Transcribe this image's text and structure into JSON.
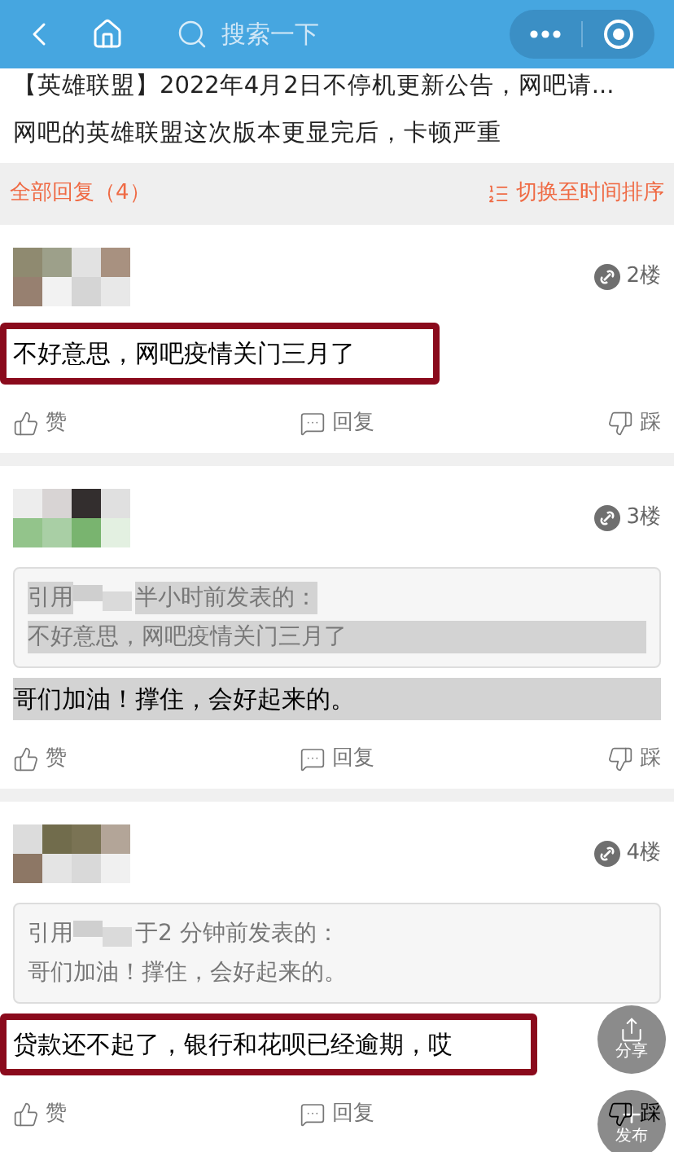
{
  "header": {
    "search_placeholder": "搜索一下"
  },
  "thread": {
    "title": "【英雄联盟】2022年4月2日不停机更新公告，网吧请...",
    "body": "网吧的英雄联盟这次版本更显完后，卡顿严重"
  },
  "replies_bar": {
    "count_label": "全部回复（4）",
    "sort_label": "切换至时间排序"
  },
  "posts": [
    {
      "floor": "2楼",
      "text": "不好意思，网吧疫情关门三月了",
      "highlighted": true,
      "shaded": false,
      "actions": [
        "赞",
        "回复",
        "踩"
      ]
    },
    {
      "floor": "3楼",
      "quote": {
        "prefix": "引用",
        "suffix": "半小时前发表的：",
        "text": "不好意思，网吧疫情关门三月了",
        "shaded": true
      },
      "text": "哥们加油！撑住，会好起来的。",
      "highlighted": false,
      "shaded": true,
      "actions": [
        "赞",
        "回复",
        "踩"
      ]
    },
    {
      "floor": "4楼",
      "quote": {
        "prefix": "引用",
        "suffix": "于2 分钟前发表的：",
        "text": "哥们加油！撑住，会好起来的。",
        "shaded": false
      },
      "text": "贷款还不起了，银行和花呗已经逾期，哎",
      "highlighted": true,
      "shaded": false,
      "actions": [
        "赞",
        "回复",
        "踩"
      ]
    }
  ],
  "floating_buttons": [
    {
      "kind": "share",
      "label": "分享"
    },
    {
      "kind": "post",
      "label": "发布"
    }
  ]
}
